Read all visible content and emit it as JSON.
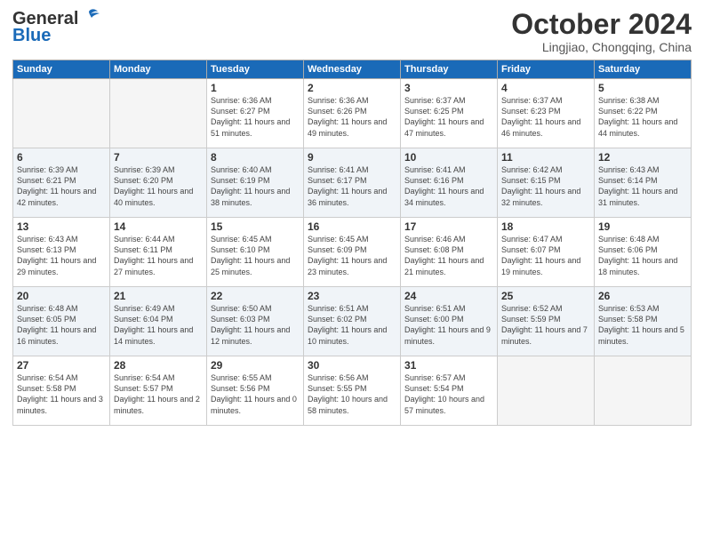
{
  "logo": {
    "line1": "General",
    "line2": "Blue"
  },
  "header": {
    "month": "October 2024",
    "location": "Lingjiao, Chongqing, China"
  },
  "weekdays": [
    "Sunday",
    "Monday",
    "Tuesday",
    "Wednesday",
    "Thursday",
    "Friday",
    "Saturday"
  ],
  "weeks": [
    [
      {
        "day": "",
        "empty": true
      },
      {
        "day": "",
        "empty": true
      },
      {
        "day": "1",
        "info": "Sunrise: 6:36 AM\nSunset: 6:27 PM\nDaylight: 11 hours\nand 51 minutes."
      },
      {
        "day": "2",
        "info": "Sunrise: 6:36 AM\nSunset: 6:26 PM\nDaylight: 11 hours\nand 49 minutes."
      },
      {
        "day": "3",
        "info": "Sunrise: 6:37 AM\nSunset: 6:25 PM\nDaylight: 11 hours\nand 47 minutes."
      },
      {
        "day": "4",
        "info": "Sunrise: 6:37 AM\nSunset: 6:23 PM\nDaylight: 11 hours\nand 46 minutes."
      },
      {
        "day": "5",
        "info": "Sunrise: 6:38 AM\nSunset: 6:22 PM\nDaylight: 11 hours\nand 44 minutes."
      }
    ],
    [
      {
        "day": "6",
        "info": "Sunrise: 6:39 AM\nSunset: 6:21 PM\nDaylight: 11 hours\nand 42 minutes."
      },
      {
        "day": "7",
        "info": "Sunrise: 6:39 AM\nSunset: 6:20 PM\nDaylight: 11 hours\nand 40 minutes."
      },
      {
        "day": "8",
        "info": "Sunrise: 6:40 AM\nSunset: 6:19 PM\nDaylight: 11 hours\nand 38 minutes."
      },
      {
        "day": "9",
        "info": "Sunrise: 6:41 AM\nSunset: 6:17 PM\nDaylight: 11 hours\nand 36 minutes."
      },
      {
        "day": "10",
        "info": "Sunrise: 6:41 AM\nSunset: 6:16 PM\nDaylight: 11 hours\nand 34 minutes."
      },
      {
        "day": "11",
        "info": "Sunrise: 6:42 AM\nSunset: 6:15 PM\nDaylight: 11 hours\nand 32 minutes."
      },
      {
        "day": "12",
        "info": "Sunrise: 6:43 AM\nSunset: 6:14 PM\nDaylight: 11 hours\nand 31 minutes."
      }
    ],
    [
      {
        "day": "13",
        "info": "Sunrise: 6:43 AM\nSunset: 6:13 PM\nDaylight: 11 hours\nand 29 minutes."
      },
      {
        "day": "14",
        "info": "Sunrise: 6:44 AM\nSunset: 6:11 PM\nDaylight: 11 hours\nand 27 minutes."
      },
      {
        "day": "15",
        "info": "Sunrise: 6:45 AM\nSunset: 6:10 PM\nDaylight: 11 hours\nand 25 minutes."
      },
      {
        "day": "16",
        "info": "Sunrise: 6:45 AM\nSunset: 6:09 PM\nDaylight: 11 hours\nand 23 minutes."
      },
      {
        "day": "17",
        "info": "Sunrise: 6:46 AM\nSunset: 6:08 PM\nDaylight: 11 hours\nand 21 minutes."
      },
      {
        "day": "18",
        "info": "Sunrise: 6:47 AM\nSunset: 6:07 PM\nDaylight: 11 hours\nand 19 minutes."
      },
      {
        "day": "19",
        "info": "Sunrise: 6:48 AM\nSunset: 6:06 PM\nDaylight: 11 hours\nand 18 minutes."
      }
    ],
    [
      {
        "day": "20",
        "info": "Sunrise: 6:48 AM\nSunset: 6:05 PM\nDaylight: 11 hours\nand 16 minutes."
      },
      {
        "day": "21",
        "info": "Sunrise: 6:49 AM\nSunset: 6:04 PM\nDaylight: 11 hours\nand 14 minutes."
      },
      {
        "day": "22",
        "info": "Sunrise: 6:50 AM\nSunset: 6:03 PM\nDaylight: 11 hours\nand 12 minutes."
      },
      {
        "day": "23",
        "info": "Sunrise: 6:51 AM\nSunset: 6:02 PM\nDaylight: 11 hours\nand 10 minutes."
      },
      {
        "day": "24",
        "info": "Sunrise: 6:51 AM\nSunset: 6:00 PM\nDaylight: 11 hours\nand 9 minutes."
      },
      {
        "day": "25",
        "info": "Sunrise: 6:52 AM\nSunset: 5:59 PM\nDaylight: 11 hours\nand 7 minutes."
      },
      {
        "day": "26",
        "info": "Sunrise: 6:53 AM\nSunset: 5:58 PM\nDaylight: 11 hours\nand 5 minutes."
      }
    ],
    [
      {
        "day": "27",
        "info": "Sunrise: 6:54 AM\nSunset: 5:58 PM\nDaylight: 11 hours\nand 3 minutes."
      },
      {
        "day": "28",
        "info": "Sunrise: 6:54 AM\nSunset: 5:57 PM\nDaylight: 11 hours\nand 2 minutes."
      },
      {
        "day": "29",
        "info": "Sunrise: 6:55 AM\nSunset: 5:56 PM\nDaylight: 11 hours\nand 0 minutes."
      },
      {
        "day": "30",
        "info": "Sunrise: 6:56 AM\nSunset: 5:55 PM\nDaylight: 10 hours\nand 58 minutes."
      },
      {
        "day": "31",
        "info": "Sunrise: 6:57 AM\nSunset: 5:54 PM\nDaylight: 10 hours\nand 57 minutes."
      },
      {
        "day": "",
        "empty": true
      },
      {
        "day": "",
        "empty": true
      }
    ]
  ]
}
